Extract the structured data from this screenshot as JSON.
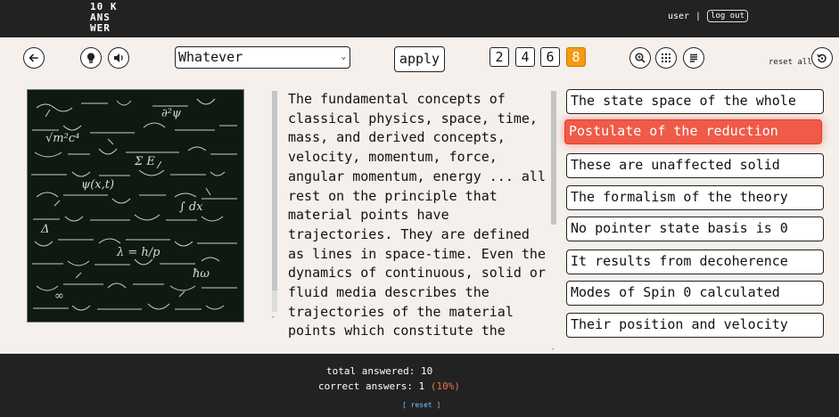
{
  "logo": {
    "line1": "10 K",
    "line2": "ANS",
    "line3": "WER"
  },
  "header": {
    "user_label": "user",
    "separator": "|",
    "logout_label": "log out"
  },
  "toolbar": {
    "category_selected": "Whatever",
    "apply_label": "apply",
    "counts": [
      "2",
      "4",
      "6",
      "8"
    ],
    "active_count": "8",
    "reset_all_label": "reset all"
  },
  "passage": {
    "text": "The fundamental concepts of classical physics, space, time, mass, and derived concepts, velocity, momentum, force, angular momentum, energy ... all rest on the principle that material points have trajectories. They are defined as lines in space-time. Even the dynamics of continuous, solid or fluid media describes the trajectories of the material points which constitute the"
  },
  "options": [
    {
      "label": "The state space of the whole"
    },
    {
      "label": "Postulate of the reduction"
    },
    {
      "label": "These are unaffected solid"
    },
    {
      "label": "The formalism of the theory"
    },
    {
      "label": "No pointer state basis is 0"
    },
    {
      "label": "It results from decoherence"
    },
    {
      "label": "Modes of Spin 0 calculated"
    },
    {
      "label": "Their position and velocity"
    }
  ],
  "selected_option": 1,
  "footer": {
    "total_label": "total answered:",
    "total_value": "10",
    "correct_label": "correct answers:",
    "correct_value": "1",
    "correct_pct": "(10%)",
    "reset_label": "[ reset ]"
  },
  "colors": {
    "accent_orange": "#f39c12",
    "selected_red": "#f05a48",
    "dark": "#222222",
    "background": "#f5f0eb"
  },
  "icons": [
    "back-arrow-icon",
    "lightbulb-icon",
    "speaker-icon",
    "zoom-in-icon",
    "grid-icon",
    "text-align-icon",
    "reset-icon"
  ]
}
